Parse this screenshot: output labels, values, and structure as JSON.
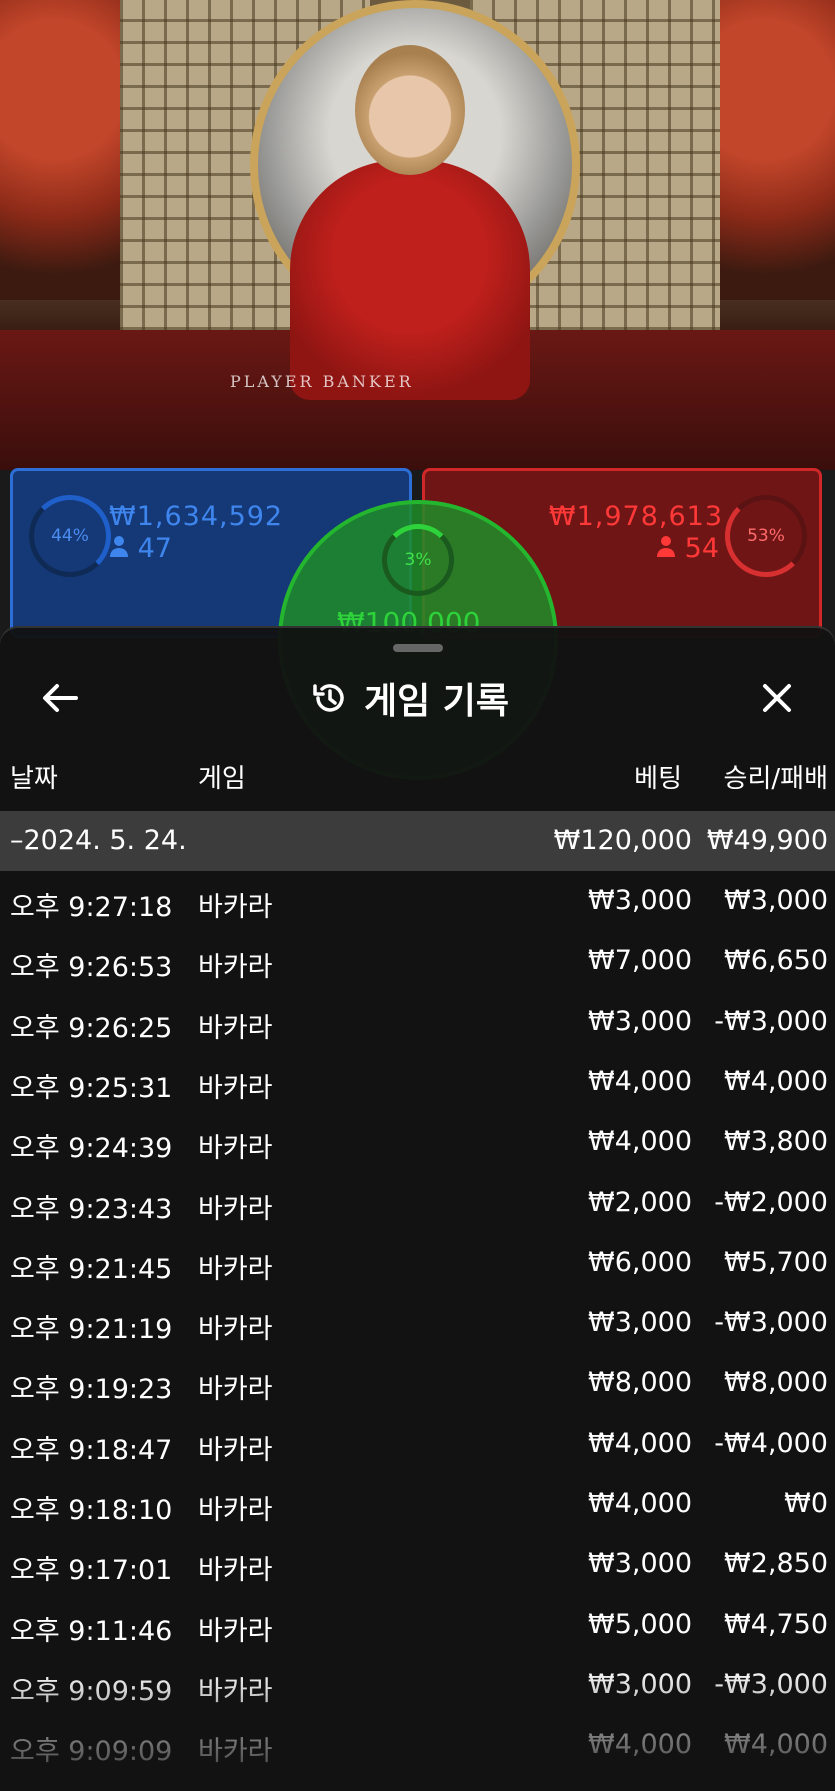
{
  "table": {
    "felt_text": "PLAYER        BANKER"
  },
  "bets": {
    "player": {
      "percent": "44%",
      "amount": "₩1,634,592",
      "count": "47"
    },
    "banker": {
      "percent": "53%",
      "amount": "₩1,978,613",
      "count": "54"
    },
    "tie": {
      "percent": "3%",
      "amount": "₩100,000"
    }
  },
  "history": {
    "title": "게임 기록",
    "columns": {
      "date": "날짜",
      "game": "게임",
      "bet": "베팅",
      "result": "승리/패배"
    },
    "summary": {
      "date": "–2024. 5. 24.",
      "bet": "₩120,000",
      "result": "₩49,900"
    },
    "rows": [
      {
        "time": "오후 9:27:18",
        "game": "바카라",
        "bet": "₩3,000",
        "result": "₩3,000"
      },
      {
        "time": "오후 9:26:53",
        "game": "바카라",
        "bet": "₩7,000",
        "result": "₩6,650"
      },
      {
        "time": "오후 9:26:25",
        "game": "바카라",
        "bet": "₩3,000",
        "result": "-₩3,000"
      },
      {
        "time": "오후 9:25:31",
        "game": "바카라",
        "bet": "₩4,000",
        "result": "₩4,000"
      },
      {
        "time": "오후 9:24:39",
        "game": "바카라",
        "bet": "₩4,000",
        "result": "₩3,800"
      },
      {
        "time": "오후 9:23:43",
        "game": "바카라",
        "bet": "₩2,000",
        "result": "-₩2,000"
      },
      {
        "time": "오후 9:21:45",
        "game": "바카라",
        "bet": "₩6,000",
        "result": "₩5,700"
      },
      {
        "time": "오후 9:21:19",
        "game": "바카라",
        "bet": "₩3,000",
        "result": "-₩3,000"
      },
      {
        "time": "오후 9:19:23",
        "game": "바카라",
        "bet": "₩8,000",
        "result": "₩8,000"
      },
      {
        "time": "오후 9:18:47",
        "game": "바카라",
        "bet": "₩4,000",
        "result": "-₩4,000"
      },
      {
        "time": "오후 9:18:10",
        "game": "바카라",
        "bet": "₩4,000",
        "result": "₩0"
      },
      {
        "time": "오후 9:17:01",
        "game": "바카라",
        "bet": "₩3,000",
        "result": "₩2,850"
      },
      {
        "time": "오후 9:11:46",
        "game": "바카라",
        "bet": "₩5,000",
        "result": "₩4,750"
      },
      {
        "time": "오후 9:09:59",
        "game": "바카라",
        "bet": "₩3,000",
        "result": "-₩3,000"
      },
      {
        "time": "오후 9:09:09",
        "game": "바카라",
        "bet": "₩4,000",
        "result": "₩4,000"
      }
    ]
  },
  "icons": {
    "back": "arrow-left-icon",
    "history": "history-clock-icon",
    "close": "close-icon",
    "user": "user-icon"
  }
}
